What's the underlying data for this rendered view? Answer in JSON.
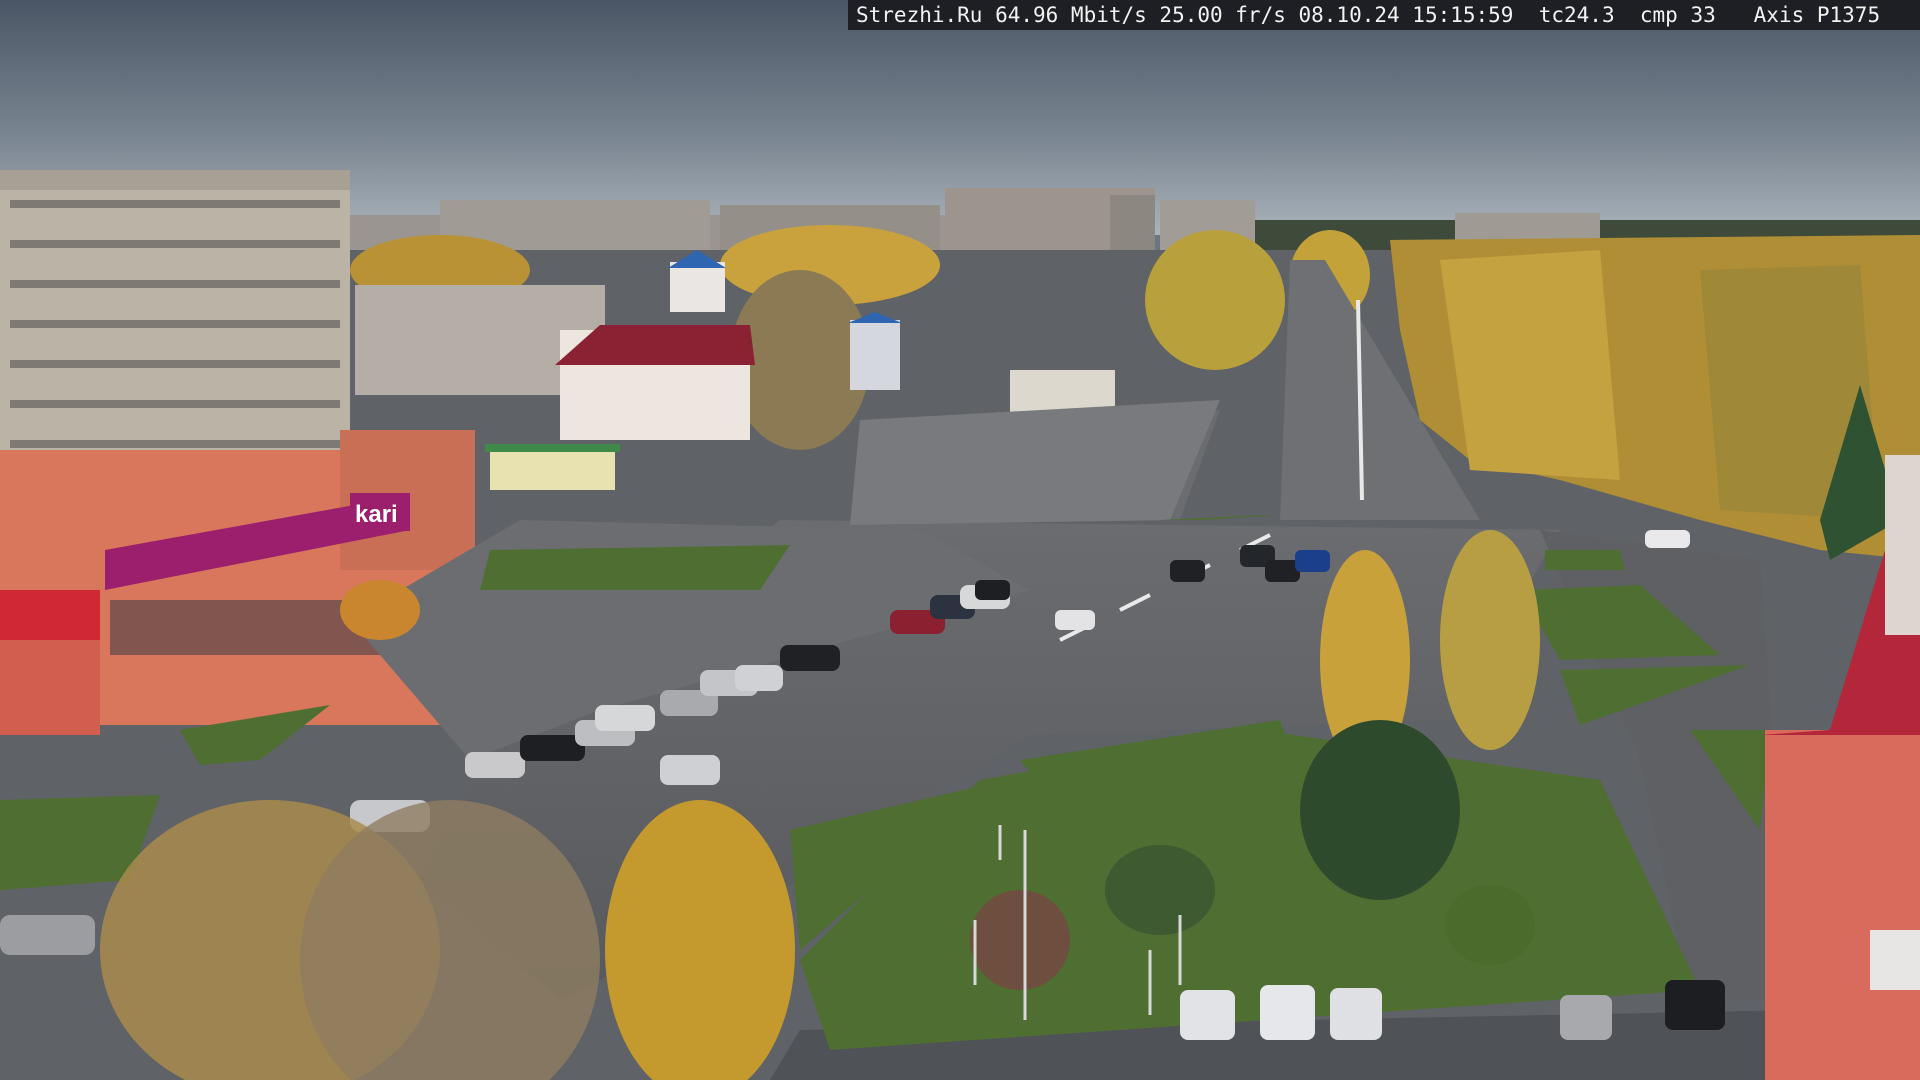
{
  "osd": {
    "text": "Strezhi.Ru 64.96 Mbit/s 25.00 fr/s 08.10.24 15:15:59  tc24.3  cmp 33   Axis P1375"
  },
  "signs": {
    "store_brand": "kari"
  },
  "colors": {
    "sky_top": "#4d5a69",
    "sky_horizon": "#a9b2ba",
    "asphalt": "#5d6064",
    "grass": "#4e6e32",
    "autumn_yellow": "#c7a13a",
    "store_pink": "#9b1f6c",
    "roof_red": "#b4263a"
  }
}
